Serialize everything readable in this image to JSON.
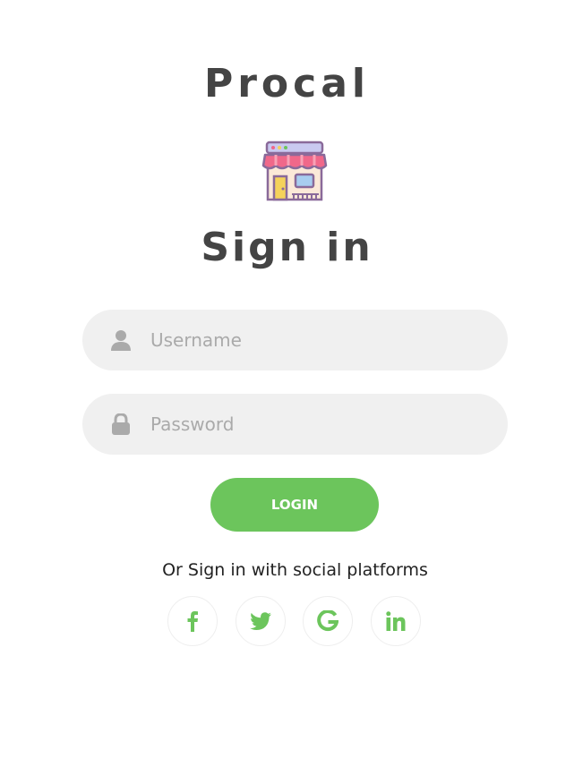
{
  "brand": {
    "name": "Procal"
  },
  "logo": {
    "icon": "storefront-icon"
  },
  "form": {
    "title": "Sign in",
    "username": {
      "placeholder": "Username",
      "value": "",
      "icon": "user-icon"
    },
    "password": {
      "placeholder": "Password",
      "value": "",
      "icon": "lock-icon"
    },
    "login_label": "LOGIN"
  },
  "social": {
    "text": "Or Sign in with social platforms",
    "platforms": [
      {
        "name": "facebook",
        "icon": "facebook-icon"
      },
      {
        "name": "twitter",
        "icon": "twitter-icon"
      },
      {
        "name": "google",
        "icon": "google-icon"
      },
      {
        "name": "linkedin",
        "icon": "linkedin-icon"
      }
    ]
  },
  "colors": {
    "accent": "#6cc55c",
    "heading": "#444444",
    "field_bg": "#f0f0f0",
    "placeholder": "#aaaaaa"
  }
}
